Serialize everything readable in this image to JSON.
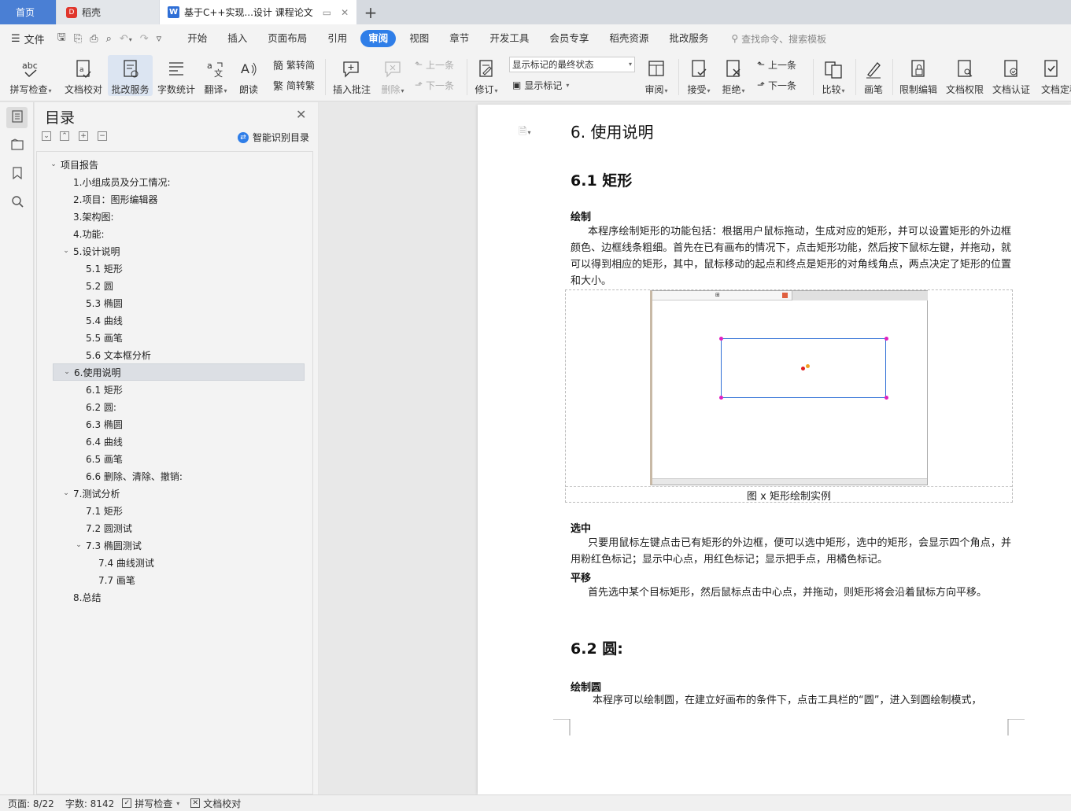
{
  "tabs": {
    "home": "首页",
    "daoke": "稻壳",
    "document": "基于C++实现...设计 课程论文"
  },
  "menu": {
    "file": "文件",
    "tabs": [
      "开始",
      "插入",
      "页面布局",
      "引用",
      "审阅",
      "视图",
      "章节",
      "开发工具",
      "会员专享",
      "稻壳资源",
      "批改服务"
    ],
    "active_tab": "审阅",
    "search": "查找命令、搜索模板"
  },
  "ribbon": {
    "spell_check": "拼写检查",
    "doc_proofread": "文档校对",
    "correction_service": "批改服务",
    "word_count": "字数统计",
    "translate": "翻译",
    "read_aloud": "朗读",
    "trad_to_simp": "繁转简",
    "simp_to_trad": "简转繁",
    "insert_comment": "插入批注",
    "delete": "删除",
    "prev_comment": "上一条",
    "next_comment": "下一条",
    "revise": "修订",
    "markup_state": "显示标记的最终状态",
    "show_markup": "显示标记",
    "review": "审阅",
    "accept": "接受",
    "reject": "拒绝",
    "prev_change": "上一条",
    "next_change": "下一条",
    "compare": "比较",
    "pen": "画笔",
    "restrict_edit": "限制编辑",
    "doc_permission": "文档权限",
    "doc_cert": "文档认证",
    "doc_final": "文档定稿"
  },
  "toc": {
    "title": "目录",
    "smart_detect": "智能识别目录",
    "items": [
      {
        "label": "项目报告",
        "level": 0,
        "toggle": "open"
      },
      {
        "label": "1.小组成员及分工情况:",
        "level": 1,
        "toggle": ""
      },
      {
        "label": "2.项目：图形编辑器",
        "level": 1,
        "toggle": ""
      },
      {
        "label": "3.架构图:",
        "level": 1,
        "toggle": ""
      },
      {
        "label": "4.功能:",
        "level": 1,
        "toggle": ""
      },
      {
        "label": "5.设计说明",
        "level": 1,
        "toggle": "open"
      },
      {
        "label": "5.1  矩形",
        "level": 2,
        "toggle": ""
      },
      {
        "label": "5.2  圆",
        "level": 2,
        "toggle": ""
      },
      {
        "label": "5.3  椭圆",
        "level": 2,
        "toggle": ""
      },
      {
        "label": "5.4 曲线",
        "level": 2,
        "toggle": ""
      },
      {
        "label": "5.5 画笔",
        "level": 2,
        "toggle": ""
      },
      {
        "label": "5.6 文本框分析",
        "level": 2,
        "toggle": ""
      },
      {
        "label": "6.使用说明",
        "level": 1,
        "toggle": "open"
      },
      {
        "label": "6.1  矩形",
        "level": 2,
        "toggle": ""
      },
      {
        "label": "6.2 圆:",
        "level": 2,
        "toggle": ""
      },
      {
        "label": "6.3 椭圆",
        "level": 2,
        "toggle": ""
      },
      {
        "label": "6.4 曲线",
        "level": 2,
        "toggle": ""
      },
      {
        "label": "6.5 画笔",
        "level": 2,
        "toggle": ""
      },
      {
        "label": "6.6 删除、清除、撤销:",
        "level": 2,
        "toggle": ""
      },
      {
        "label": "7.测试分析",
        "level": 1,
        "toggle": "open"
      },
      {
        "label": "7.1  矩形",
        "level": 2,
        "toggle": ""
      },
      {
        "label": "7.2 圆测试",
        "level": 2,
        "toggle": ""
      },
      {
        "label": "7.3 椭圆测试",
        "level": 2,
        "toggle": "open"
      },
      {
        "label": "7.4 曲线测试",
        "level": 3,
        "toggle": ""
      },
      {
        "label": "7.7 画笔",
        "level": 3,
        "toggle": ""
      },
      {
        "label": "8.总结",
        "level": 1,
        "toggle": ""
      }
    ],
    "selected_index": 12
  },
  "document": {
    "h1": "6. 使用说明",
    "h2_rect": "6.1  矩形",
    "draw_heading": "绘制",
    "draw_text": "本程序绘制矩形的功能包括：根据用户鼠标拖动，生成对应的矩形，并可以设置矩形的外边框颜色、边框线条粗细。首先在已有画布的情况下，点击矩形功能，然后按下鼠标左键，并拖动，就可以得到相应的矩形，其中，鼠标移动的起点和终点是矩形的对角线角点，两点决定了矩形的位置和大小。",
    "figure_caption": "图 x  矩形绘制实例",
    "select_heading": "选中",
    "select_text": "只要用鼠标左键点击已有矩形的外边框，便可以选中矩形，选中的矩形，会显示四个角点，并用粉红色标记；显示中心点，用红色标记；显示把手点，用橘色标记。",
    "move_heading": "平移",
    "move_text": "首先选中某个目标矩形，然后鼠标点击中心点，并拖动，则矩形将会沿着鼠标方向平移。",
    "h2_circle": "6.2 圆:",
    "circle_heading": "绘制圆",
    "circle_text": "本程序可以绘制圆，在建立好画布的条件下，点击工具栏的“圆”，进入到圆绘制模式，"
  },
  "status": {
    "page": "页面: 8/22",
    "words": "字数: 8142",
    "spell_check": "拼写检查",
    "doc_proofread": "文档校对"
  },
  "colors": {
    "accent": "#2f7ee8",
    "home_tab": "#4a7fd4",
    "rect_border": "#2f6fd6",
    "corner_handle": "#e020c0",
    "center_point": "#e02020",
    "grip_point": "#f0a020"
  }
}
